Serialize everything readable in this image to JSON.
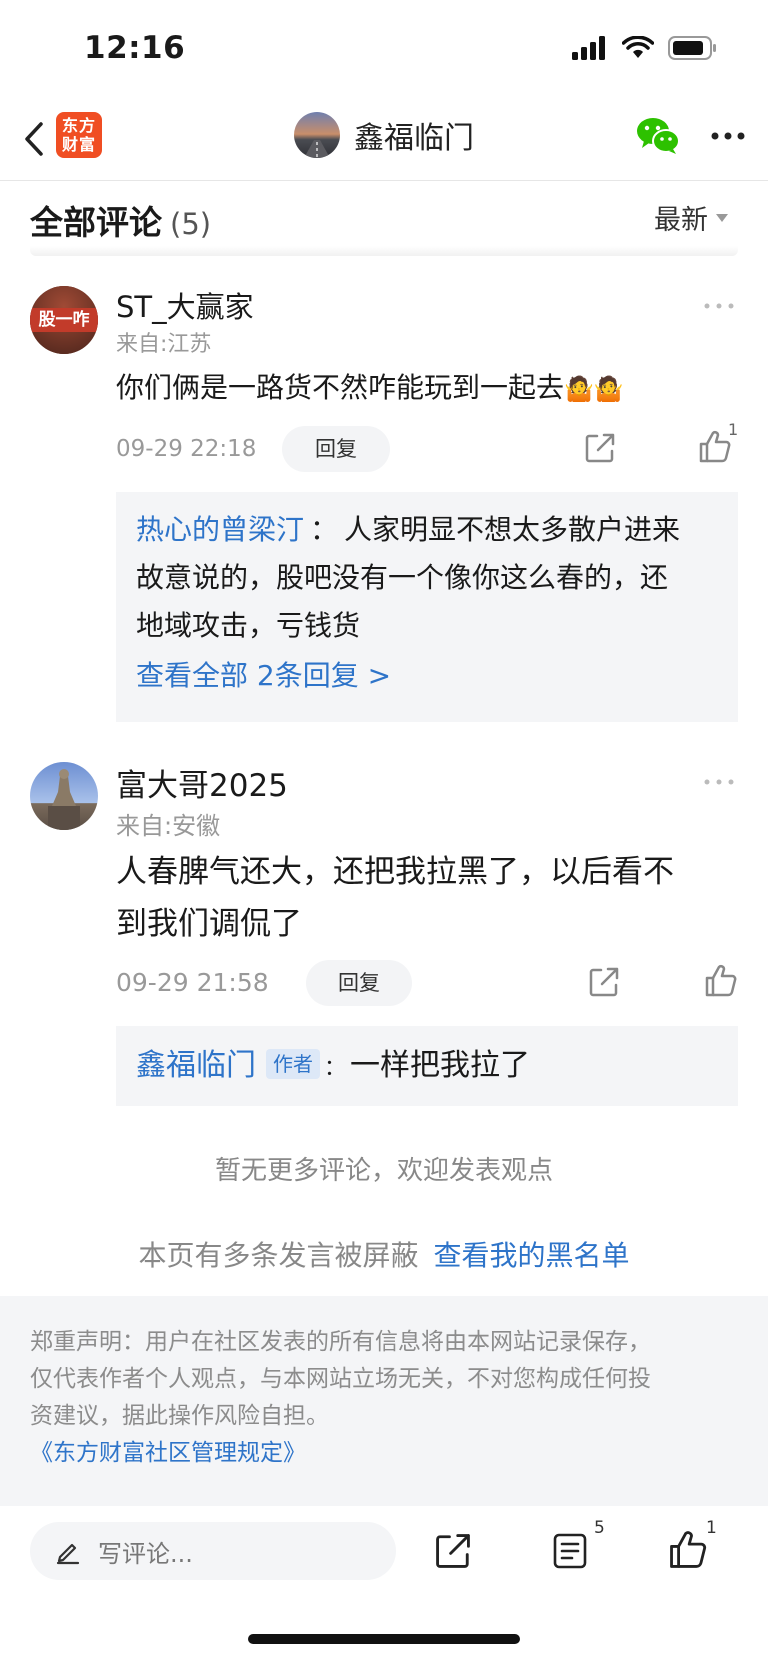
{
  "status_bar": {
    "time": "12:16"
  },
  "nav": {
    "logo_text_line1": "东方",
    "logo_text_line2": "财富",
    "title": "鑫福临门",
    "wechat_icon": "wechat-icon",
    "more_icon": "more-icon"
  },
  "header": {
    "title": "全部评论",
    "count": "(5)",
    "sort_label": "最新"
  },
  "comments": [
    {
      "avatar_text": "股一咋",
      "username": "ST_大赢家",
      "location": "来自:江苏",
      "content": "你们俩是一路货不然咋能玩到一起去",
      "emoji": "🤷🤷",
      "time": "09-29 22:18",
      "reply_label": "回复",
      "like_count": "1",
      "replies": [
        {
          "name": "热心的曾梁汀",
          "sep": "：",
          "text_line1": "人家明显不想太多散户进来",
          "text_line2": "故意说的，股吧没有一个像你这么春的，还",
          "text_line3": "地域攻击，亏钱货"
        }
      ],
      "view_all": "查看全部 2条回复 >"
    },
    {
      "username": "富大哥2025",
      "location": "来自:安徽",
      "content_line1": "人春脾气还大，还把我拉黑了，以后看不",
      "content_line2": "到我们调侃了",
      "time": "09-29 21:58",
      "reply_label": "回复",
      "like_count": "",
      "replies": [
        {
          "name": "鑫福临门",
          "tag": "作者",
          "sep": "：",
          "text": "一样把我拉了"
        }
      ]
    }
  ],
  "footer": {
    "no_more": "暂无更多评论，欢迎发表观点",
    "blocked_text": "本页有多条发言被屏蔽",
    "blacklist_link": "查看我的黑名单",
    "disclaimer_line1": "郑重声明：用户在社区发表的所有信息将由本网站记录保存，",
    "disclaimer_line2": "仅代表作者个人观点，与本网站立场无关，不对您构成任何投",
    "disclaimer_line3": "资建议，据此操作风险自担。",
    "rules_link": "《东方财富社区管理规定》"
  },
  "bottom_bar": {
    "input_placeholder": "写评论...",
    "comment_count": "5",
    "like_count": "1"
  },
  "colors": {
    "link": "#2e74c9",
    "logo": "#f04e23",
    "wechat": "#2dc100"
  }
}
